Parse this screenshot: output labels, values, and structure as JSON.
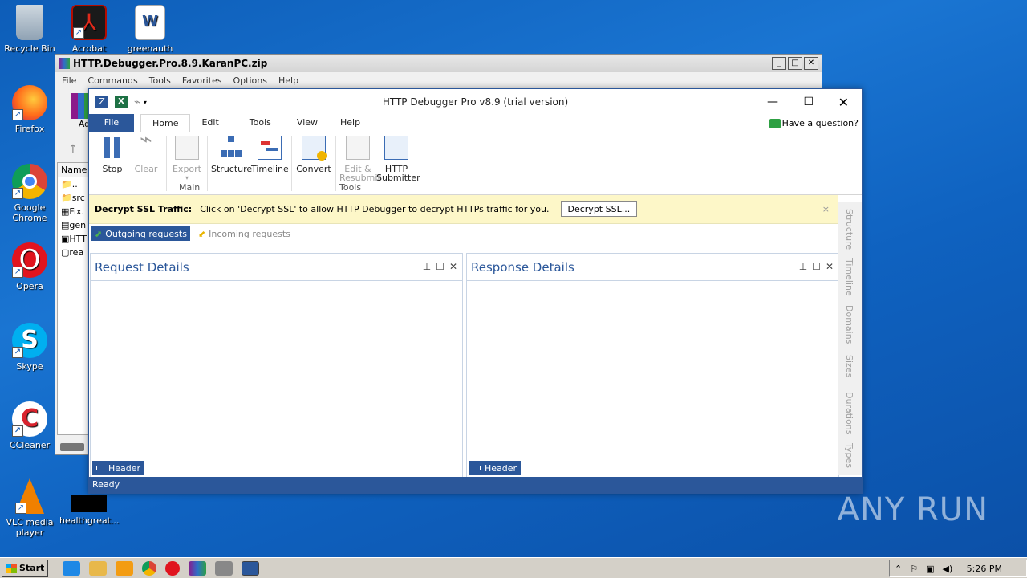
{
  "desktop": {
    "icons": [
      "Recycle Bin",
      "Acrobat",
      "greenauth",
      "Firefox",
      "Google Chrome",
      "Opera",
      "Skype",
      "CCleaner",
      "VLC media player",
      "healthgreat..."
    ]
  },
  "winrar": {
    "title": "HTTP.Debugger.Pro.8.9.KaranPC.zip",
    "menu": [
      "File",
      "Commands",
      "Tools",
      "Favorites",
      "Options",
      "Help"
    ],
    "add_label": "Ad",
    "col_name": "Name",
    "files": [
      "..",
      "src",
      "Fix.",
      "gen",
      "HTT",
      "rea"
    ]
  },
  "app": {
    "title": "HTTP Debugger Pro v8.9 (trial version)",
    "tabs": [
      "File",
      "Home",
      "Edit",
      "Tools",
      "View",
      "Help"
    ],
    "question": "Have a question?",
    "ribbon": {
      "stop": "Stop",
      "clear": "Clear",
      "export": "Export",
      "structure": "Structure",
      "timeline": "Timeline",
      "convert": "Convert",
      "edit1": "Edit &",
      "edit2": "Resubmit",
      "http1": "HTTP",
      "http2": "Submitter",
      "group_main": "Main",
      "group_tools": "Tools"
    },
    "ssl": {
      "label": "Decrypt SSL Traffic:",
      "text": "Click on 'Decrypt SSL' to allow HTTP Debugger to decrypt HTTPs traffic for you.",
      "button": "Decrypt SSL...",
      "close": "×"
    },
    "reqtabs": {
      "outgoing": "Outgoing requests",
      "incoming": "Incoming requests"
    },
    "request_title": "Request Details",
    "response_title": "Response Details",
    "header_btn": "Header",
    "side": [
      "Structure",
      "Timeline",
      "Domains",
      "Sizes",
      "Durations",
      "Types"
    ],
    "status": "Ready"
  },
  "taskbar": {
    "start": "Start",
    "time": "5:26 PM"
  },
  "watermark": "ANY RUN",
  "colors": {
    "accent": "#2b579a",
    "ssl_bar": "#fdf7c8"
  }
}
